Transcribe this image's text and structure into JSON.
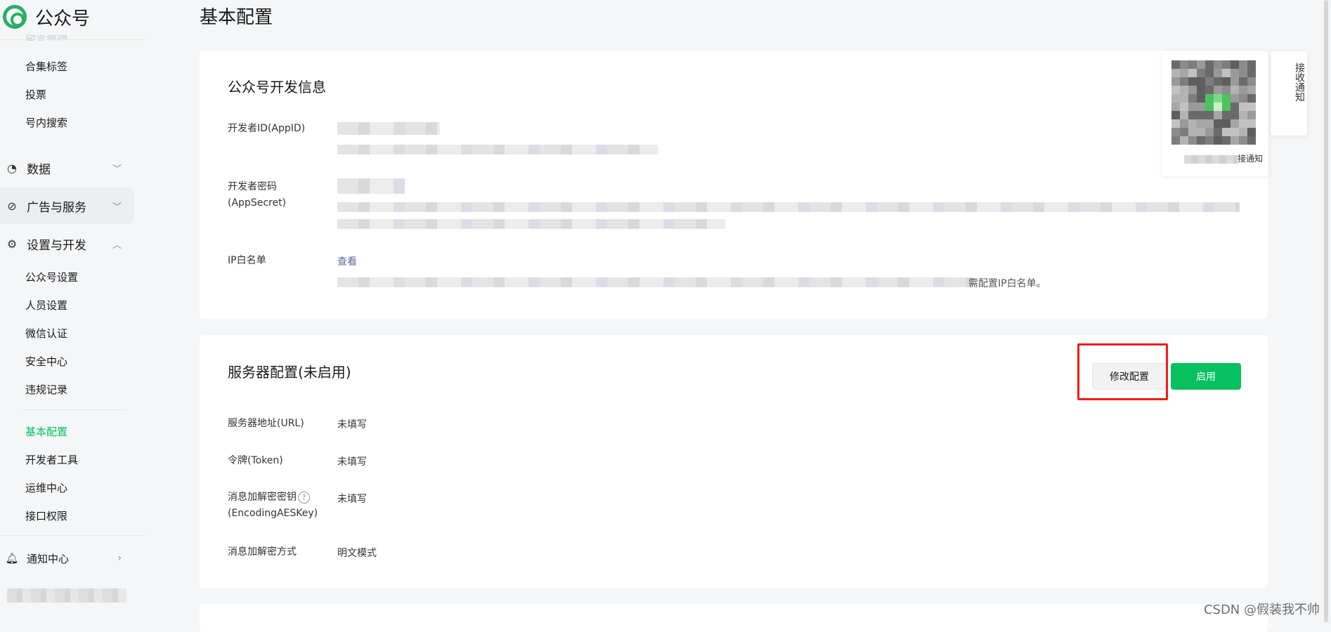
{
  "app": {
    "name": "公众号",
    "brand_color": "#07c160"
  },
  "sidebar": {
    "cut_item": "留言管理",
    "top_items": [
      {
        "label": "合集标签"
      },
      {
        "label": "投票"
      },
      {
        "label": "号内搜索"
      }
    ],
    "groups": {
      "data": {
        "label": "数据",
        "icon": "chart-icon",
        "chevron": "﹀"
      },
      "ads": {
        "label": "广告与服务",
        "icon": "compass-icon",
        "chevron": "﹀"
      },
      "settings": {
        "label": "设置与开发",
        "icon": "gear-icon",
        "chevron": "︿"
      }
    },
    "settings_items": [
      {
        "label": "公众号设置"
      },
      {
        "label": "人员设置"
      },
      {
        "label": "微信认证"
      },
      {
        "label": "安全中心"
      },
      {
        "label": "违规记录"
      }
    ],
    "dev_items": [
      {
        "label": "基本配置",
        "active": true
      },
      {
        "label": "开发者工具"
      },
      {
        "label": "运维中心"
      },
      {
        "label": "接口权限"
      }
    ],
    "notify": {
      "label": "通知中心",
      "icon": "bell-icon",
      "chevron": "›"
    }
  },
  "main": {
    "page_title": "基本配置",
    "dev_info": {
      "title": "公众号开发信息",
      "appid_label": "开发者ID(AppID)",
      "secret_label": "开发者密码(AppSecret)",
      "ip_label": "IP白名单",
      "ip_link": "查看",
      "ip_note": "需配置IP白名单。"
    },
    "server": {
      "title": "服务器配置(未启用)",
      "modify_button": "修改配置",
      "enable_button": "启用",
      "rows": [
        {
          "label": "服务器地址(URL)",
          "value": "未填写"
        },
        {
          "label": "令牌(Token)",
          "value": "未填写"
        },
        {
          "label": "消息加解密密钥",
          "label2": "(EncodingAESKey)",
          "value": "未填写"
        },
        {
          "label": "消息加解密方式",
          "value": "明文模式"
        }
      ],
      "help_glyph": "?"
    }
  },
  "qr_panel": {
    "caption_tail": "接通知"
  },
  "side_tab": {
    "label": "接收通知"
  },
  "watermark": "CSDN @假装我不帅",
  "colors": {
    "highlight_box": "#f21b1b",
    "link": "#576b95"
  }
}
